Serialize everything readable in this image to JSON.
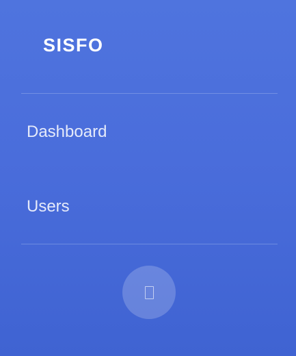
{
  "sidebar": {
    "brand": "SISFO",
    "items": [
      {
        "label": "Dashboard"
      },
      {
        "label": "Users"
      }
    ],
    "toggle_icon": "sidebar-toggle-icon"
  },
  "colors": {
    "background_top": "#4f74de",
    "background_bottom": "#3f63d2",
    "text": "#ffffff"
  }
}
